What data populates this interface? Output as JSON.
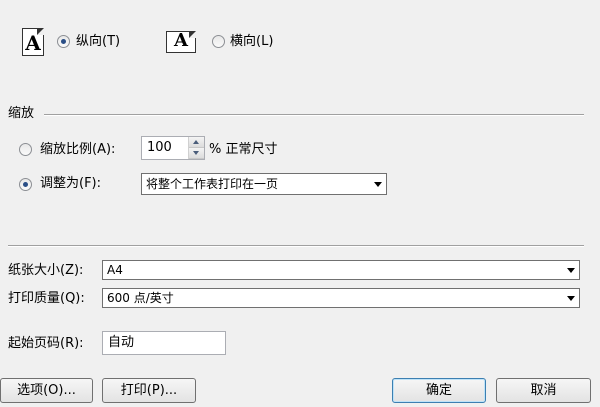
{
  "orientation": {
    "portrait_label": "纵向(T)",
    "landscape_label": "横向(L)",
    "icon_letter": "A"
  },
  "scaling": {
    "section_title": "缩放",
    "scale_label": "缩放比例(A):",
    "scale_value": "100",
    "scale_suffix": "% 正常尺寸",
    "fit_label": "调整为(F):",
    "fit_value": "将整个工作表打印在一页"
  },
  "paper": {
    "size_label": "纸张大小(Z):",
    "size_value": "A4",
    "quality_label": "打印质量(Q):",
    "quality_value": "600 点/英寸",
    "first_page_label": "起始页码(R):",
    "first_page_value": "自动"
  },
  "buttons": {
    "options": "选项(O)...",
    "print": "打印(P)...",
    "ok": "确定",
    "cancel": "取消"
  }
}
